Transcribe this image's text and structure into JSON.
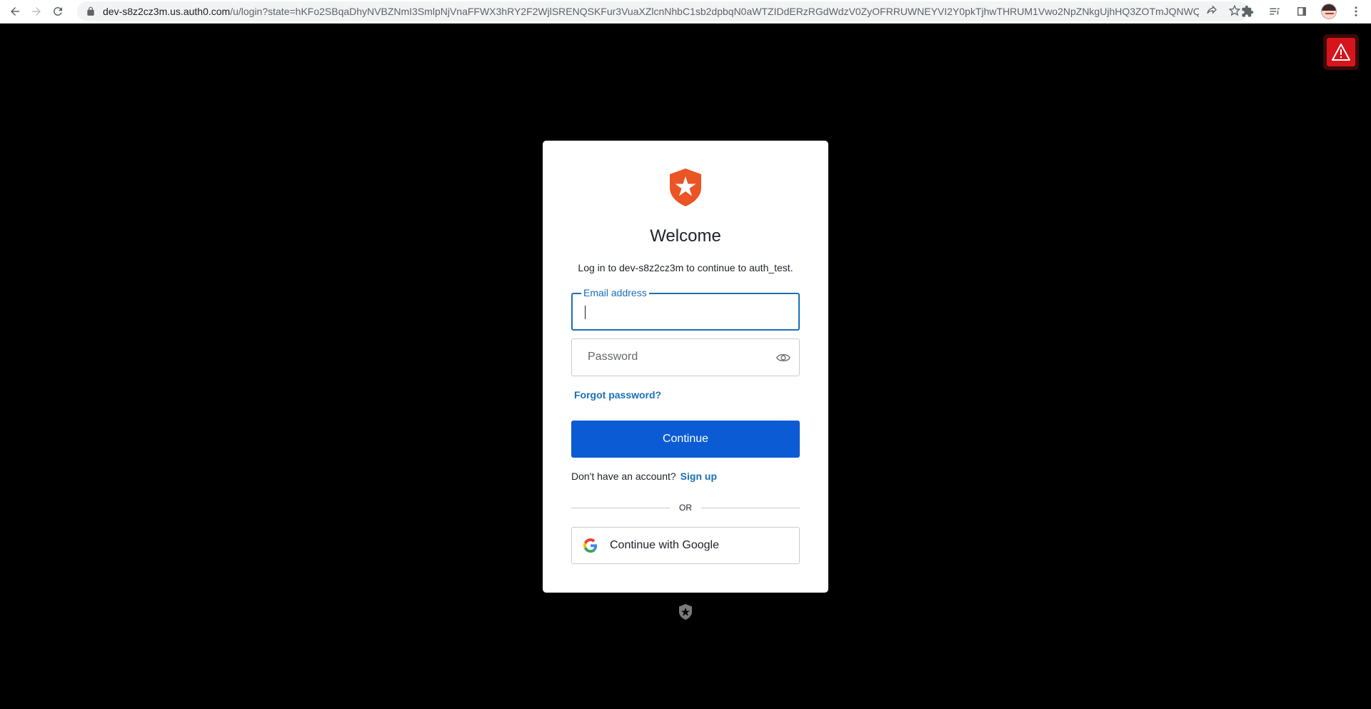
{
  "browser": {
    "url_host": "dev-s8z2cz3m.us.auth0.com",
    "url_path": "/u/login?state=hKFo2SBqaDhyNVBZNmI3SmlpNjVnaFFWX3hRY2F2WjlSRENQSKFur3VuaXZlcnNhbC1sb2dpbqN0aWTZIDdERzRGdWdzV0ZyOFRRUWNEYVI2Y0pkTjhwTHRUM1Vwo2NpZNkgUjhHQ3ZOTmJQNWQzNm5ya..."
  },
  "login": {
    "title": "Welcome",
    "subtitle": "Log in to dev-s8z2cz3m to continue to auth_test.",
    "email_label": "Email address",
    "email_value": "",
    "password_placeholder": "Password",
    "forgot_password": "Forgot password?",
    "continue_label": "Continue",
    "no_account_text": "Don't have an account?",
    "signup_label": "Sign up",
    "divider_text": "OR",
    "google_label": "Continue with Google"
  },
  "colors": {
    "brand": "#eb5424",
    "primary_button": "#0a5bd4",
    "link": "#1a6fb8",
    "background": "#000000",
    "warning": "#d6141c"
  },
  "icons": [
    "back-arrow-icon",
    "forward-arrow-icon",
    "reload-icon",
    "lock-icon",
    "share-icon",
    "star-icon",
    "extensions-icon",
    "reading-list-icon",
    "side-panel-icon",
    "profile-avatar",
    "menu-kebab-icon",
    "warning-icon",
    "auth0-logo-icon",
    "eye-icon",
    "google-g-icon"
  ]
}
